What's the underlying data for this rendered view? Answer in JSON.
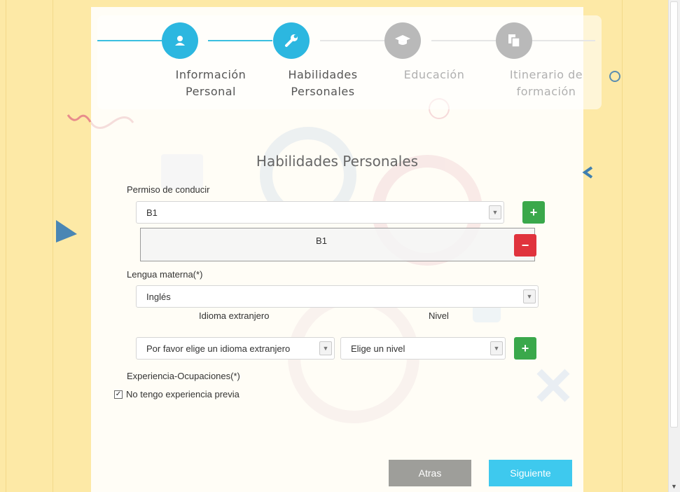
{
  "stepper": {
    "steps": [
      {
        "label_line1": "Información",
        "label_line2": "Personal",
        "icon": "user-icon",
        "state": "active"
      },
      {
        "label_line1": "Habilidades",
        "label_line2": "Personales",
        "icon": "wrench-icon",
        "state": "active"
      },
      {
        "label_line1": "Educación",
        "label_line2": "",
        "icon": "graduation-cap-icon",
        "state": "inactive"
      },
      {
        "label_line1": "Itinerario de",
        "label_line2": "formación",
        "icon": "documents-icon",
        "state": "inactive"
      }
    ]
  },
  "form": {
    "title": "Habilidades Personales",
    "driving_license": {
      "label": "Permiso de conducir",
      "selected": "B1",
      "added_items": [
        "B1"
      ]
    },
    "mother_tongue": {
      "label": "Lengua materna(*)",
      "selected": "Inglés"
    },
    "foreign_language": {
      "column_language": "Idioma extranjero",
      "column_level": "Nivel",
      "language_selected": "Por favor elige un idioma extranjero",
      "level_selected": "Elige un nivel"
    },
    "experience": {
      "label": "Experiencia-Ocupaciones(*)",
      "checkbox_label": "No tengo experiencia previa",
      "checked": true
    }
  },
  "buttons": {
    "back": "Atras",
    "next": "Siguiente",
    "add_symbol": "+",
    "remove_symbol": "−"
  },
  "colors": {
    "accent": "#2cb7e0",
    "inactive_step": "#b9b9b9",
    "add_button": "#3aa84b",
    "remove_button": "#e0333d",
    "back_button": "#9e9e9a",
    "next_button": "#3ec9ee",
    "page_background": "#fde9a6"
  }
}
